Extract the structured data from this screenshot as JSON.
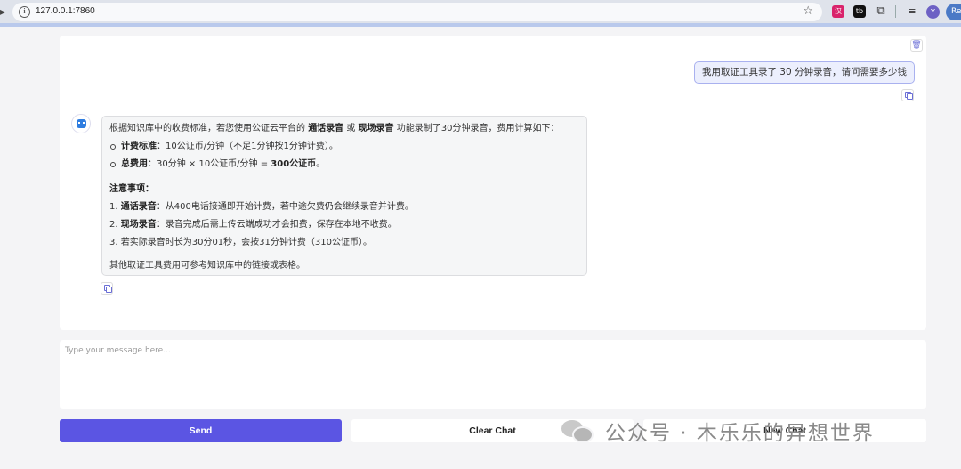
{
  "browser": {
    "url": "127.0.0.1:7860",
    "ext_a_label": "汉",
    "ext_b_label": "tb",
    "profile_initial": "Y",
    "profile_badge": "Re"
  },
  "chat": {
    "user_message": "我用取证工具录了 30 分钟录音，请问需要多少钱",
    "bot": {
      "intro_1": "根据知识库中的收费标准，若您使用公证云平台的 ",
      "intro_b1": "通话录音",
      "intro_2": " 或 ",
      "intro_b2": "现场录音",
      "intro_3": " 功能录制了30分钟录音，费用计算如下：",
      "bullet1_label": "计费标准",
      "bullet1_text": "：10公证币/分钟（不足1分钟按1分钟计费）。",
      "bullet2_label": "总费用",
      "bullet2_text": "：30分钟 × 10公证币/分钟 = ",
      "bullet2_total": "300公证币",
      "bullet2_end": "。",
      "notes_heading": "注意事项：",
      "note1_prefix": "1. ",
      "note1_label": "通话录音",
      "note1_text": "：从400电话接通即开始计费，若中途欠费仍会继续录音并计费。",
      "note2_prefix": "2. ",
      "note2_label": "现场录音",
      "note2_text": "：录音完成后需上传云端成功才会扣费，保存在本地不收费。",
      "note3": "3. 若实际录音时长为30分01秒，会按31分钟计费（310公证币）。",
      "footer": "其他取证工具费用可参考知识库中的链接或表格。"
    }
  },
  "input": {
    "placeholder": "Type your message here..."
  },
  "buttons": {
    "send": "Send",
    "clear": "Clear Chat",
    "new": "New Chat"
  },
  "watermark": {
    "text": "公众号 · 木乐乐的异想世界"
  },
  "colors": {
    "accent": "#5b55e3",
    "user_bubble_border": "#a9b1ef"
  }
}
